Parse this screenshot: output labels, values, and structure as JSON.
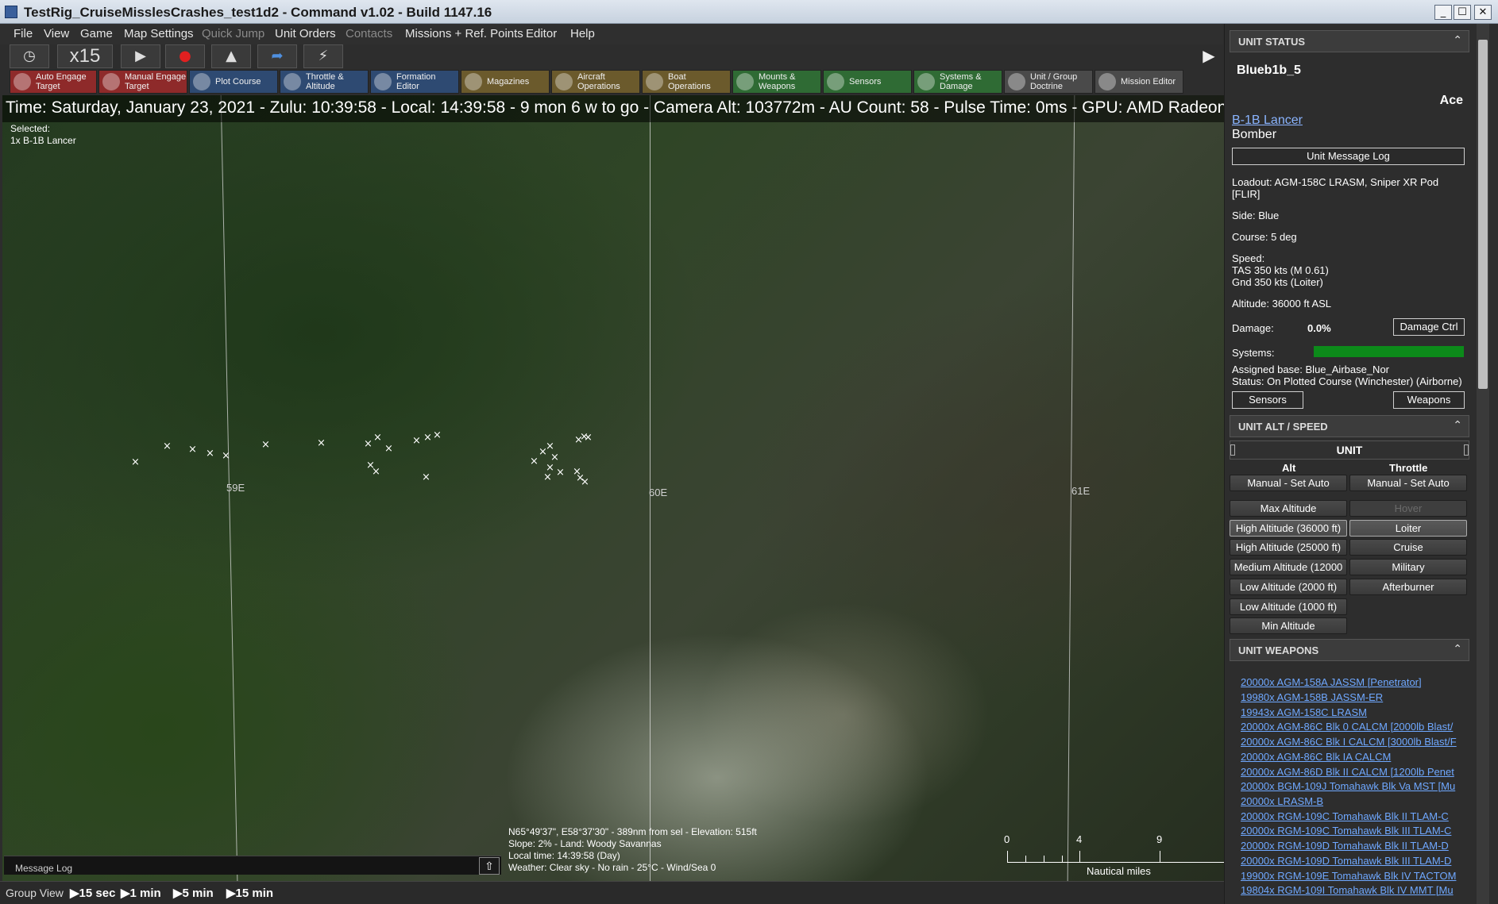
{
  "window": {
    "title": "TestRig_CruiseMisslesCrashes_test1d2 - Command v1.02 - Build 1147.16",
    "buttons": {
      "minimize": "_",
      "maximize": "☐",
      "close": "✕"
    }
  },
  "menu": {
    "items": [
      {
        "label": "File",
        "enabled": true
      },
      {
        "label": "View",
        "enabled": true
      },
      {
        "label": "Game",
        "enabled": true
      },
      {
        "label": "Map Settings",
        "enabled": true
      },
      {
        "label": "Quick Jump",
        "enabled": false
      },
      {
        "label": "Unit Orders",
        "enabled": true
      },
      {
        "label": "Contacts",
        "enabled": false
      },
      {
        "label": "Missions + Ref. Points",
        "enabled": true
      },
      {
        "label": "Editor",
        "enabled": true
      },
      {
        "label": "Help",
        "enabled": true
      }
    ]
  },
  "timecontrols": {
    "speed": "x15",
    "icons": [
      "clock-icon",
      "play-icon",
      "record-icon",
      "runway-icon",
      "jump-icon",
      "lightning-icon"
    ]
  },
  "toolbar": {
    "items": [
      {
        "label": "Auto Engage Target",
        "color": "#8e2a2a"
      },
      {
        "label": "Manual Engage Target",
        "color": "#8e2a2a"
      },
      {
        "label": "Plot Course",
        "color": "#2e4a72"
      },
      {
        "label": "Throttle & Altitude",
        "color": "#2e4a72"
      },
      {
        "label": "Formation Editor",
        "color": "#2e4a72"
      },
      {
        "label": "Magazines",
        "color": "#6b5a2c"
      },
      {
        "label": "Aircraft Operations",
        "color": "#6b5a2c"
      },
      {
        "label": "Boat Operations",
        "color": "#6b5a2c"
      },
      {
        "label": "Mounts & Weapons",
        "color": "#2f6b34"
      },
      {
        "label": "Sensors",
        "color": "#2f6b34"
      },
      {
        "label": "Systems & Damage",
        "color": "#2f6b34"
      },
      {
        "label": "Unit / Group Doctrine",
        "color": "#4a4a4a"
      },
      {
        "label": "Mission Editor",
        "color": "#4a4a4a"
      }
    ]
  },
  "map": {
    "infobar": "Time: Saturday, January 23, 2021 - Zulu: 10:39:58 - Local: 14:39:58 - 9 mon 6 w to go -  Camera Alt: 103772m  - AU Count: 58 - Pulse Time: 0ms - GPU: AMD Radeon R",
    "selected_label": "Selected:",
    "selected_unit": "1x B-1B Lancer",
    "longitudes": [
      "59E",
      "60E",
      "61E"
    ],
    "unit_marker": "×",
    "cursor_info": [
      "N65°49'37\", E58°37'30\" - 389nm from sel - Elevation: 515ft",
      "Slope: 2%  - Land: Woody Savannas",
      "Local time: 14:39:58 (Day)",
      "Weather: Clear sky - No rain - 25°C - Wind/Sea 0"
    ],
    "scale": {
      "ticks": [
        "0",
        "4",
        "9"
      ],
      "unit": "Nautical miles"
    },
    "message_log": "Message Log",
    "colors": {
      "vegetation": "#2f4526",
      "snow": "#d2d7c8"
    }
  },
  "bottombar": {
    "group_view": "Group View",
    "steps": [
      "15 sec",
      "1 min",
      "5 min",
      "15 min"
    ]
  },
  "unit_status": {
    "header": "UNIT STATUS",
    "name": "Blueb1b_5",
    "proficiency": "Ace",
    "class": "B-1B Lancer",
    "type": "Bomber",
    "message_log_btn": "Unit Message Log",
    "loadout": "Loadout: AGM-158C LRASM, Sniper XR Pod",
    "loadout2": "[FLIR]",
    "side": "Side: Blue",
    "course": "Course: 5 deg",
    "speed_label": "Speed:",
    "tas": "TAS 350 kts (M 0.61)",
    "gnd": "Gnd 350 kts (Loiter)",
    "altitude": "Altitude: 36000 ft ASL",
    "damage_label": "Damage:",
    "damage_value": "0.0%",
    "damage_btn": "Damage Ctrl",
    "systems_label": "Systems:",
    "systems_health": 1.0,
    "systems_color": "#0c8a1a",
    "assigned_base": "Assigned base: Blue_Airbase_Nor",
    "status": "Status: On Plotted Course (Winchester) (Airborne)",
    "sensors_btn": "Sensors",
    "weapons_btn": "Weapons"
  },
  "alt_speed": {
    "header": "UNIT ALT / SPEED",
    "unit_label": "UNIT",
    "alt_label": "Alt",
    "throttle_label": "Throttle",
    "alt_manual": "Manual - Set Auto",
    "throttle_manual": "Manual - Set Auto",
    "alt_buttons": [
      "Max Altitude",
      "High Altitude (36000 ft)",
      "High Altitude (25000 ft)",
      "Medium Altitude (12000",
      "Low Altitude (2000 ft)",
      "Low Altitude (1000 ft)",
      "Min Altitude"
    ],
    "throttle_buttons": [
      "Hover",
      "Loiter",
      "Cruise",
      "Military",
      "Afterburner"
    ]
  },
  "weapons": {
    "header": "UNIT WEAPONS",
    "items": [
      "20000x AGM-158A JASSM [Penetrator]",
      "19980x AGM-158B JASSM-ER",
      "19943x AGM-158C LRASM",
      "20000x AGM-86C Blk 0 CALCM [2000lb Blast/",
      "20000x AGM-86C Blk I CALCM [3000lb Blast/F",
      "20000x AGM-86C Blk IA CALCM",
      "20000x AGM-86D Blk II CALCM [1200lb Penet",
      "20000x BGM-109J Tomahawk Blk Va MST [Mu",
      "20000x LRASM-B",
      "20000x RGM-109C Tomahawk Blk II TLAM-C",
      "20000x RGM-109C Tomahawk Blk III TLAM-C",
      "20000x RGM-109D Tomahawk Blk II TLAM-D",
      "20000x RGM-109D Tomahawk Blk III TLAM-D",
      "19900x RGM-109E Tomahawk Blk IV TACTOM",
      "19804x RGM-109I Tomahawk Blk IV MMT [Mu"
    ]
  }
}
